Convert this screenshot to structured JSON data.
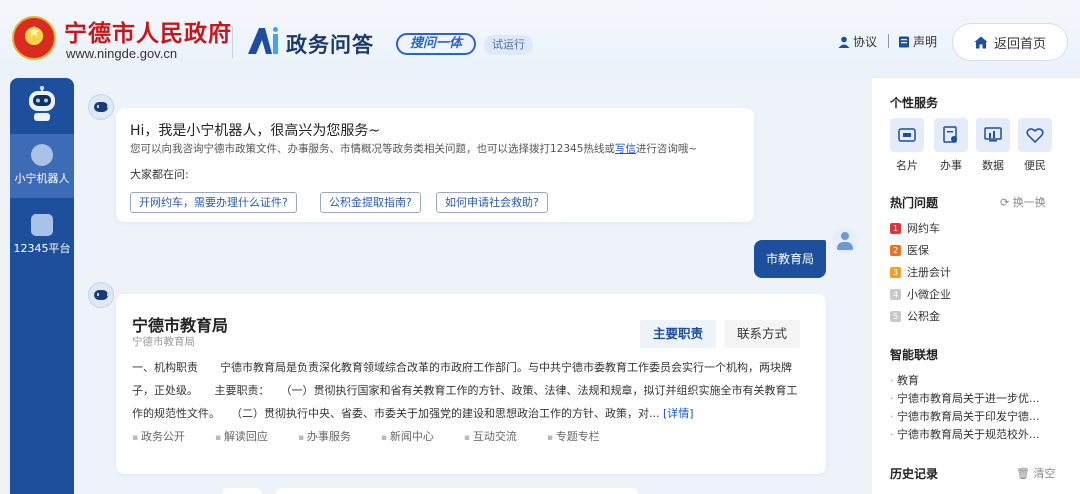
{
  "header": {
    "site_name": "宁德市人民政府",
    "site_url": "www.ningde.gov.cn",
    "service_title": "政务问答",
    "slogan": "搜问一体",
    "beta_badge": "试运行",
    "links": {
      "agreement": "协议",
      "statement": "声明"
    },
    "home_button": "返回首页"
  },
  "sidebar": {
    "items": [
      {
        "label": "小宁机器人",
        "active": true
      },
      {
        "label": "12345平台",
        "active": false
      }
    ]
  },
  "greeting": {
    "title": "Hi，我是小宁机器人，很高兴为您服务~",
    "desc_before": "您可以向我咨询宁德市政策文件、办事服务、市情概况等政务类相关问题，也可以选择拨打12345热线或",
    "desc_link": "写信",
    "desc_after": "进行咨询哦~",
    "ask_label": "大家都在问:",
    "chips": [
      "开网约车，需要办理什么证件?",
      "公积金提取指南?",
      "如何申请社会救助?"
    ]
  },
  "user_message": "市教育局",
  "dept_card": {
    "title": "宁德市教育局",
    "subtitle": "宁德市教育局",
    "tabs": [
      "主要职责",
      "联系方式"
    ],
    "text": "一、机构职责　　宁德市教育局是负责深化教育领域综合改革的市政府工作部门。与中共宁德市委教育工作委员会实行一个机构，两块牌子，正处级。　　主要职责：　　（一）贯彻执行国家和省有关教育工作的方针、政策、法律、法规和规章，拟订并组织实施全市有关教育工作的规范性文件。　　（二）贯彻执行中央、省委、市委关于加强党的建设和思想政治工作的方针、政策，对...",
    "more_link": "[详情]",
    "links": [
      "政务公开",
      "解读回应",
      "办事服务",
      "新闻中心",
      "互动交流",
      "专题专栏"
    ]
  },
  "right_panel": {
    "personal_title": "个性服务",
    "services": [
      "名片",
      "办事",
      "数据",
      "便民"
    ],
    "hot_title": "热门问题",
    "refresh_label": "换一换",
    "hot_items": [
      {
        "num": "1",
        "label": "网约车",
        "color": "#d9363e"
      },
      {
        "num": "2",
        "label": "医保",
        "color": "#e8742a"
      },
      {
        "num": "3",
        "label": "注册会计",
        "color": "#e8a22a"
      },
      {
        "num": "4",
        "label": "小微企业",
        "color": "#c9c9c9"
      },
      {
        "num": "5",
        "label": "公积金",
        "color": "#c9c9c9"
      }
    ],
    "smart_title": "智能联想",
    "suggestions": [
      "教育",
      "宁德市教育局关于进一步优...",
      "宁德市教育局关于印发宁德...",
      "宁德市教育局关于规范校外..."
    ],
    "history_title": "历史记录",
    "clear_label": "清空"
  },
  "colors": {
    "primary": "#1e4f9c",
    "brand_red": "#c8161d",
    "link": "#1a57c9"
  }
}
